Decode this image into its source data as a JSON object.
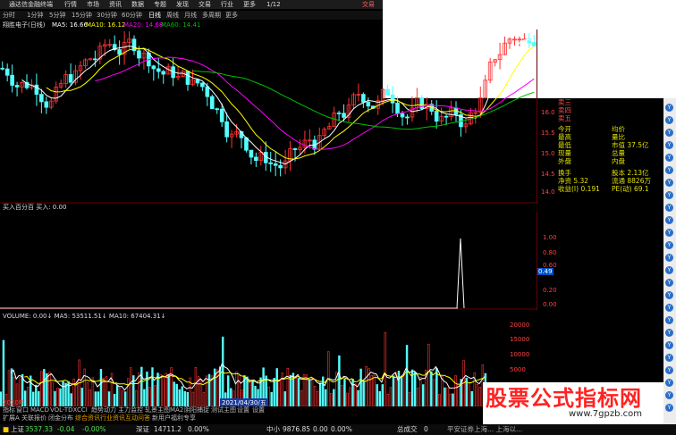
{
  "titlebar": {
    "app": "通达信金融终端",
    "menus": [
      "行情",
      "市场",
      "资讯",
      "数据",
      "专题",
      "发现",
      "交易",
      "行业",
      "更多",
      "1/12"
    ],
    "trade": "交易"
  },
  "period": [
    "分时",
    "1分钟",
    "5分钟",
    "15分钟",
    "30分钟",
    "60分钟",
    "日线",
    "周线",
    "月线",
    "多周期",
    "更多"
  ],
  "ma_legend": {
    "stock": "翔胜电子(日线)",
    "ma5": "MA5: 16.66",
    "ma10": "MA10: 16.12",
    "ma20": "MA20: 14.68",
    "ma60": "MA60: 14.41"
  },
  "price_axis": [
    "16.00",
    "15.50",
    "15.00",
    "14.50",
    "14.00",
    "13.50",
    "13.00"
  ],
  "price_marker": "13.83→13.8",
  "right_panel": {
    "rows": [
      [
        "卖三",
        ""
      ],
      [
        "卖四",
        ""
      ],
      [
        "卖五",
        ""
      ],
      [
        "今开",
        "均价"
      ],
      [
        "最高",
        "量比"
      ],
      [
        "最低",
        "市值 37.5亿"
      ],
      [
        "现量",
        "总量"
      ],
      [
        "外盘",
        "内盘"
      ],
      [
        "换手",
        "股本 2.13亿"
      ],
      [
        "净资 5.32",
        "流通 8826万"
      ],
      [
        "收益(I) 0.191",
        "PE(动) 69.1"
      ]
    ]
  },
  "indicator": {
    "header": "买入百分百 买入: 0.00",
    "axis": [
      "1.00",
      "0.80",
      "0.60",
      "0.49",
      "0.20",
      "0.00"
    ],
    "marker": "0.49"
  },
  "volume": {
    "header": "VOLUME: 0.00↓  MA5: 53511.51↓  MA10: 67404.31↓",
    "axis": [
      "20000",
      "15000",
      "10000",
      "5000"
    ],
    "date_label": "2021/04/30/五",
    "year_label": "2020年",
    "x_ticks": [
      "4",
      "5",
      "6",
      "7",
      "8",
      "9",
      "10"
    ]
  },
  "tabs1": [
    "指标",
    "窗口",
    "MACD",
    "VOL-TDX",
    "CCI",
    "趋势动力",
    "主力监控",
    "轧景主图",
    "MA2",
    "阴阳捕捉",
    "测试主图",
    "设置",
    "设置"
  ],
  "tabs2": [
    "扩展A",
    "关联报价",
    "闭金分布",
    "综合资讯",
    "行业资讯",
    "互动问答",
    "新用户福利专享"
  ],
  "status": {
    "sh_label": "上证",
    "sh_value": "3537.33",
    "sh_change": "-0.04",
    "sh_pct": "-0.00%",
    "sz_label": "深证",
    "sz_value": "14711.2",
    "sz_pct": "0.00%",
    "zx_label": "中小",
    "zx_value": "9876.85",
    "zx_pct": "0.00",
    "zx_pct2": "0.00%",
    "total_label": "总成交",
    "total_value": "0",
    "news": "平安证券上海... 上海以..."
  },
  "watermark": {
    "text": "股票公式指标网",
    "url": "www.7gpzb.com"
  },
  "colors": {
    "background": "#000000",
    "up": "#ff3232",
    "down": "#54ffff",
    "ma5": "#ffffff",
    "ma10": "#ffff00",
    "ma20": "#ff00ff",
    "ma60": "#00c000"
  }
}
